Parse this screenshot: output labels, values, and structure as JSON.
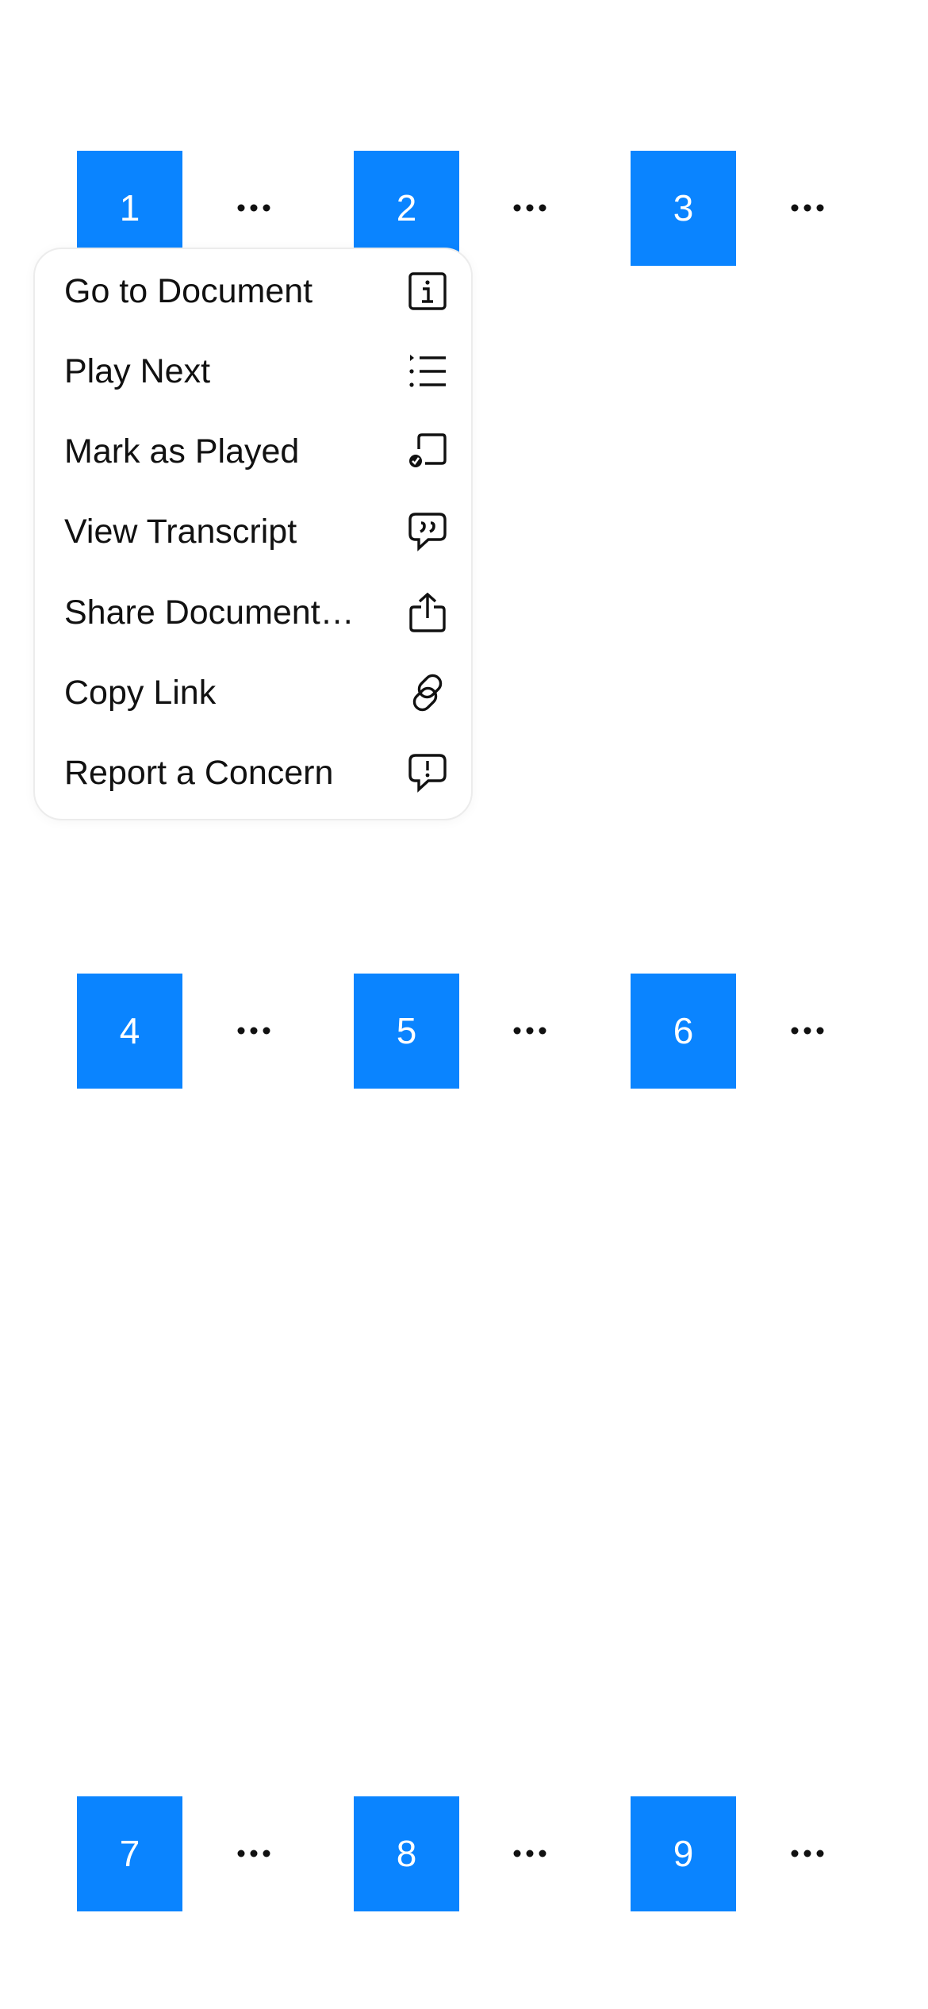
{
  "tiles": [
    "1",
    "2",
    "3",
    "4",
    "5",
    "6",
    "7",
    "8",
    "9"
  ],
  "colors": {
    "tile": "#0a84ff",
    "tile_text": "#ffffff",
    "menu_text": "#111111"
  },
  "more_icon": "ellipsis-icon",
  "menu": {
    "items": [
      {
        "label": "Go to Document",
        "icon": "info-icon"
      },
      {
        "label": "Play Next",
        "icon": "list-icon"
      },
      {
        "label": "Mark as Played",
        "icon": "played-check-icon"
      },
      {
        "label": "View Transcript",
        "icon": "quote-bubble-icon"
      },
      {
        "label": "Share Document…",
        "icon": "share-icon"
      },
      {
        "label": "Copy Link",
        "icon": "link-icon"
      },
      {
        "label": "Report a Concern",
        "icon": "report-bubble-icon"
      }
    ]
  }
}
